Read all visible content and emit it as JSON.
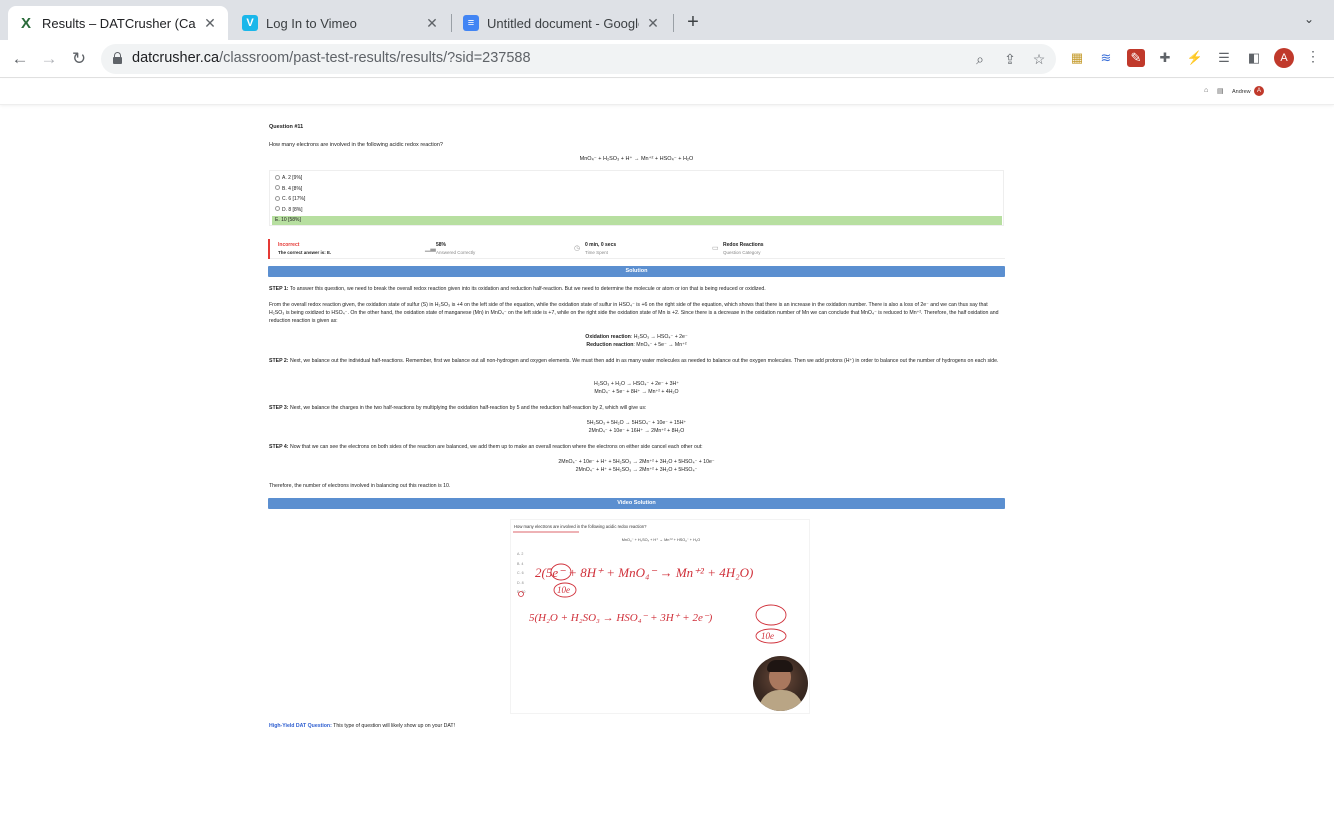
{
  "browser": {
    "tabs": [
      {
        "title": "Results – DATCrusher (Canadian",
        "favicon": "X",
        "active": true
      },
      {
        "title": "Log In to Vimeo",
        "favicon": "V",
        "active": false
      },
      {
        "title": "Untitled document - Google Do",
        "favicon": "≡",
        "active": false
      }
    ],
    "url_host": "datcrusher.ca",
    "url_path": "/classroom/past-test-results/results/?sid=237588",
    "profile_initial": "A"
  },
  "site": {
    "user_name": "Andrew",
    "user_initial": "A"
  },
  "question": {
    "number": "Question #11",
    "text": "How many electrons are involved in the following acidic redox reaction?",
    "equation": "MnO₄⁻ + H₂SO₃ + H⁺ → Mn⁺² + HSO₄⁻ + H₂O",
    "options": [
      {
        "label": "A. 2 [9%]",
        "correct": false
      },
      {
        "label": "B. 4 [8%]",
        "correct": false
      },
      {
        "label": "C. 6 [17%]",
        "correct": false
      },
      {
        "label": "D. 8 [8%]",
        "correct": false
      },
      {
        "label": "E. 10 [58%]",
        "correct": true
      }
    ]
  },
  "stats": {
    "result_title": "Incorrect",
    "result_detail": "The correct answer is: E.",
    "correctness_value": "58%",
    "correctness_label": "Answered Correctly",
    "time_value": "0 min, 0 secs",
    "time_label": "Time Spent",
    "category_value": "Redox Reactions",
    "category_label": "Question Category"
  },
  "solution": {
    "header": "Solution",
    "step1_label": "STEP 1:",
    "step1_text": " To answer this question, we need to break the overall redox reaction given into its oxidation and reduction half-reaction. But we need to determine the molecule or atom or ion that is being reduced or oxidized.",
    "para2": "From the overall redox reaction given, the oxidation state of sulfur (S) in H₂SO₃ is +4 on the left side of the equation, while the oxidation state of sulfur in HSO₄⁻ is +6 on the right side of the equation, which shows that there is an increase in the oxidation number. There is also a loss of 2e⁻ and we can thus say that H₂SO₃ is being oxidized to HSO₄⁻. On the other hand, the oxidation state of manganese (Mn) in MnO₄⁻ on the left side is +7, while on the right side the oxidation state of Mn is +2. Since there is a decrease in the oxidation number of Mn we can conclude that MnO₄⁻ is reduced to Mn⁺². Therefore, the half oxidation and reduction reaction is given as:",
    "oxidation_label": "Oxidation reaction",
    "oxidation_eq": ": H₂SO₃ → HSO₄⁻ + 2e⁻",
    "reduction_label": "Reduction reaction",
    "reduction_eq": ": MnO₄⁻ + 5e⁻ → Mn⁺²",
    "step2_label": "STEP 2:",
    "step2_text": " Next, we balance out the individual half-reactions. Remember, first we balance out all non-hydrogen and oxygen elements. We must then add in as many water molecules as needed to balance out the oxygen molecules. Then we add protons (H⁺) in order to balance out the number of hydrogens on each side.",
    "step2_eq1": "H₂SO₃ + H₂O → HSO₄⁻ + 2e⁻ + 3H⁺",
    "step2_eq2": "MnO₄⁻ + 5e⁻ + 8H⁺ → Mn⁺² + 4H₂O",
    "step3_label": "STEP 3:",
    "step3_text": " Next, we balance the charges in the two half-reactions by multiplying the oxidation half-reaction by 5 and the reduction half-reaction by 2, which will give us:",
    "step3_eq1": "5H₂SO₃ + 5H₂O → 5HSO₄⁻ + 10e⁻ + 15H⁺",
    "step3_eq2": "2MnO₄⁻ + 10e⁻ + 16H⁺ → 2Mn⁺² + 8H₂O",
    "step4_label": "STEP 4:",
    "step4_text": " Now that we can see the electrons on both sides of the reaction are balanced, we add them up to make an overall reaction where the electrons on either side cancel each other out:",
    "step4_eq1": "2MnO₄⁻ + 10e⁻ + H⁺ + 5H₂SO₃ → 2Mn⁺² + 3H₂O + 5HSO₄⁻ + 10e⁻",
    "step4_eq2": "2MnO₄⁻ + H⁺ + 5H₂SO₃ → 2Mn⁺² + 3H₂O + 5HSO₄⁻",
    "conclusion": "Therefore, the number of electrons involved in balancing out this reaction is 10."
  },
  "video": {
    "header": "Video Solution",
    "frame_question": "How many electrons are involved in the following acidic redox reaction?",
    "frame_equation": "MnO₄⁻ + H₂SO₃ + H⁺ → Mn⁺² + HSO₄⁻ + H₂O",
    "frame_options": [
      "A. 2",
      "B. 4",
      "C. 6",
      "D. 8",
      "E. 10"
    ],
    "handwriting_line1": "2(5e⁻ + 8H⁺ + MnO₄⁻ → Mn⁺² + 4H₂O)",
    "handwriting_10e_a": "10e",
    "handwriting_line2": "5(H₂O + H₂SO₃ → HSO₄⁻ + 3H⁺ + 2e⁻)",
    "handwriting_10e_b": "10e"
  },
  "high_yield": {
    "label": "High-Yield DAT Question:",
    "text": " This type of question will likely show up on your DAT!"
  },
  "colors": {
    "accent_blue": "#5b8fd0",
    "correct_green": "#b7dfa0",
    "incorrect_red": "#e53935",
    "ink_red": "#d0303a"
  }
}
